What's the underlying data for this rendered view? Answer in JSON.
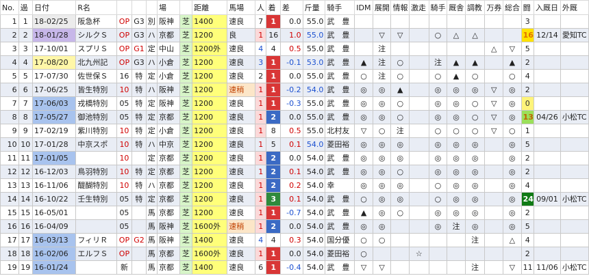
{
  "headers": [
    "No.",
    "過",
    "日付",
    "R名",
    "",
    "",
    "",
    "場",
    "",
    "距離",
    "馬場",
    "人",
    "着",
    "差",
    "斤量",
    "騎手",
    "IDM",
    "展開",
    "情報",
    "激走",
    "騎手",
    "厩舎",
    "調教",
    "万券",
    "総合",
    "闘",
    "入厩日",
    "外厩"
  ],
  "rows": [
    {
      "no": "1",
      "ka": "1",
      "date": "18-02/25",
      "rname": "阪急杯",
      "cls": "OP",
      "g": "G3",
      "j": "別",
      "place": "阪神",
      "track": "芝",
      "dist": "1400",
      "baba": "速良",
      "pop": "7",
      "rank": "1",
      "diff": "0.0",
      "kin": "55.0",
      "jockey": "武　豊",
      "idm": "",
      "tenkai": "",
      "info": "",
      "gekiso": "",
      "jm": "",
      "kyu": "",
      "cho": "",
      "man": "",
      "sogo": "",
      "to": "3",
      "nyu": "",
      "gai": ""
    },
    {
      "no": "2",
      "ka": "2",
      "date": "18-01/28",
      "rname": "シルクＳ",
      "cls": "OP",
      "g": "G3",
      "j": "ハ",
      "place": "京都",
      "track": "芝",
      "dist": "1200",
      "baba": "良",
      "pop": "1",
      "rank": "16",
      "diff": "1.0",
      "kin": "55.0",
      "jockey": "武　豊",
      "idm": "",
      "tenkai": "▽",
      "info": "▽",
      "gekiso": "",
      "jm": "○",
      "kyu": "△",
      "cho": "△",
      "man": "",
      "sogo": "",
      "to": "16",
      "nyu": "12/14",
      "gai": "愛知TC"
    },
    {
      "no": "3",
      "ka": "3",
      "date": "17-10/01",
      "rname": "スプリＳ",
      "cls": "OP",
      "g": "G1",
      "j": "定",
      "place": "中山",
      "track": "芝",
      "dist": "1200外",
      "baba": "速良",
      "pop": "4",
      "rank": "4",
      "diff": "0.5",
      "kin": "55.0",
      "jockey": "武　豊",
      "idm": "",
      "tenkai": "注",
      "info": "",
      "gekiso": "",
      "jm": "",
      "kyu": "",
      "cho": "",
      "man": "△",
      "sogo": "▽",
      "to": "5",
      "nyu": "",
      "gai": ""
    },
    {
      "no": "4",
      "ka": "4",
      "date": "17-08/20",
      "rname": "北九州記",
      "cls": "OP",
      "g": "G3",
      "j": "ハ",
      "place": "小倉",
      "track": "芝",
      "dist": "1200",
      "baba": "速良",
      "pop": "3",
      "rank": "1",
      "diff": "-0.1",
      "kin": "53.0",
      "jockey": "武　豊",
      "idm": "▲",
      "tenkai": "注",
      "info": "○",
      "gekiso": "",
      "jm": "注",
      "kyu": "▲",
      "cho": "▲",
      "man": "",
      "sogo": "▲",
      "to": "2",
      "nyu": "",
      "gai": ""
    },
    {
      "no": "5",
      "ka": "5",
      "date": "17-07/30",
      "rname": "佐世保Ｓ",
      "cls": "16",
      "g": "特",
      "j": "定",
      "place": "小倉",
      "track": "芝",
      "dist": "1200",
      "baba": "速良",
      "pop": "2",
      "rank": "1",
      "diff": "0.0",
      "kin": "55.0",
      "jockey": "武　豊",
      "idm": "○",
      "tenkai": "注",
      "info": "○",
      "gekiso": "",
      "jm": "○",
      "kyu": "▲",
      "cho": "○",
      "man": "",
      "sogo": "○",
      "to": "4",
      "nyu": "",
      "gai": ""
    },
    {
      "no": "6",
      "ka": "6",
      "date": "17-06/25",
      "rname": "皆生特別",
      "cls": "10",
      "g": "特",
      "j": "ハ",
      "place": "阪神",
      "track": "芝",
      "dist": "1200",
      "baba": "速稍",
      "pop": "1",
      "rank": "1",
      "diff": "-0.2",
      "kin": "54.0",
      "jockey": "武　豊",
      "idm": "◎",
      "tenkai": "◎",
      "info": "▲",
      "gekiso": "",
      "jm": "◎",
      "kyu": "◎",
      "cho": "◎",
      "man": "▽",
      "sogo": "◎",
      "to": "2",
      "nyu": "",
      "gai": ""
    },
    {
      "no": "7",
      "ka": "7",
      "date": "17-06/03",
      "rname": "戎橋特別",
      "cls": "05",
      "g": "特",
      "j": "定",
      "place": "阪神",
      "track": "芝",
      "dist": "1200",
      "baba": "速良",
      "pop": "1",
      "rank": "1",
      "diff": "-0.3",
      "kin": "55.0",
      "jockey": "武　豊",
      "idm": "◎",
      "tenkai": "◎",
      "info": "○",
      "gekiso": "",
      "jm": "◎",
      "kyu": "◎",
      "cho": "○",
      "man": "▽",
      "sogo": "◎",
      "to": "0",
      "nyu": "",
      "gai": ""
    },
    {
      "no": "8",
      "ka": "8",
      "date": "17-05/27",
      "rname": "御池特別",
      "cls": "05",
      "g": "特",
      "j": "定",
      "place": "京都",
      "track": "芝",
      "dist": "1200",
      "baba": "速良",
      "pop": "1",
      "rank": "2",
      "diff": "0.0",
      "kin": "55.0",
      "jockey": "武　豊",
      "idm": "◎",
      "tenkai": "◎",
      "info": "○",
      "gekiso": "",
      "jm": "◎",
      "kyu": "◎",
      "cho": "○",
      "man": "▽",
      "sogo": "◎",
      "to": "13",
      "nyu": "04/26",
      "gai": "小松TC"
    },
    {
      "no": "9",
      "ka": "9",
      "date": "17-02/19",
      "rname": "紫川特別",
      "cls": "10",
      "g": "特",
      "j": "定",
      "place": "小倉",
      "track": "芝",
      "dist": "1200",
      "baba": "速良",
      "pop": "1",
      "rank": "8",
      "diff": "0.5",
      "kin": "55.0",
      "jockey": "北村友",
      "idm": "▽",
      "tenkai": "○",
      "info": "注",
      "gekiso": "",
      "jm": "○",
      "kyu": "○",
      "cho": "○",
      "man": "▽",
      "sogo": "○",
      "to": "1",
      "nyu": "",
      "gai": ""
    },
    {
      "no": "10",
      "ka": "10",
      "date": "17-01/28",
      "rname": "中京スポ",
      "cls": "10",
      "g": "特",
      "j": "ハ",
      "place": "中京",
      "track": "芝",
      "dist": "1200",
      "baba": "速良",
      "pop": "1",
      "rank": "5",
      "diff": "0.1",
      "kin": "54.0",
      "jockey": "菱田裕",
      "idm": "◎",
      "tenkai": "◎",
      "info": "◎",
      "gekiso": "",
      "jm": "◎",
      "kyu": "◎",
      "cho": "◎",
      "man": "",
      "sogo": "◎",
      "to": "5",
      "nyu": "",
      "gai": ""
    },
    {
      "no": "11",
      "ka": "11",
      "date": "17-01/05",
      "rname": "",
      "cls": "10",
      "g": "",
      "j": "定",
      "place": "京都",
      "track": "芝",
      "dist": "1200",
      "baba": "速良",
      "pop": "1",
      "rank": "2",
      "diff": "0.0",
      "kin": "54.0",
      "jockey": "武　豊",
      "idm": "◎",
      "tenkai": "◎",
      "info": "◎",
      "gekiso": "",
      "jm": "◎",
      "kyu": "◎",
      "cho": "◎",
      "man": "",
      "sogo": "◎",
      "to": "2",
      "nyu": "",
      "gai": ""
    },
    {
      "no": "12",
      "ka": "12",
      "date": "16-12/03",
      "rname": "鳥羽特別",
      "cls": "10",
      "g": "特",
      "j": "定",
      "place": "京都",
      "track": "芝",
      "dist": "1200",
      "baba": "速良",
      "pop": "1",
      "rank": "2",
      "diff": "0.1",
      "kin": "54.0",
      "jockey": "武　豊",
      "idm": "◎",
      "tenkai": "◎",
      "info": "○",
      "gekiso": "",
      "jm": "◎",
      "kyu": "◎",
      "cho": "◎",
      "man": "",
      "sogo": "◎",
      "to": "2",
      "nyu": "",
      "gai": ""
    },
    {
      "no": "13",
      "ka": "13",
      "date": "16-11/06",
      "rname": "醍醐特別",
      "cls": "10",
      "g": "特",
      "j": "ハ",
      "place": "京都",
      "track": "芝",
      "dist": "1200",
      "baba": "速良",
      "pop": "1",
      "rank": "2",
      "diff": "0.2",
      "kin": "54.0",
      "jockey": "幸",
      "idm": "◎",
      "tenkai": "◎",
      "info": "◎",
      "gekiso": "",
      "jm": "○",
      "kyu": "◎",
      "cho": "◎",
      "man": "",
      "sogo": "◎",
      "to": "4",
      "nyu": "",
      "gai": ""
    },
    {
      "no": "14",
      "ka": "14",
      "date": "16-10/22",
      "rname": "壬生特別",
      "cls": "05",
      "g": "特",
      "j": "定",
      "place": "京都",
      "track": "芝",
      "dist": "1200",
      "baba": "速良",
      "pop": "1",
      "rank": "3",
      "diff": "0.1",
      "kin": "54.0",
      "jockey": "武　豊",
      "idm": "○",
      "tenkai": "◎",
      "info": "◎",
      "gekiso": "",
      "jm": "○",
      "kyu": "◎",
      "cho": "◎",
      "man": "",
      "sogo": "◎",
      "to": "24",
      "nyu": "09/01",
      "gai": "小松TC"
    },
    {
      "no": "15",
      "ka": "15",
      "date": "16-05/01",
      "rname": "",
      "cls": "05",
      "g": "",
      "j": "馬",
      "place": "京都",
      "track": "芝",
      "dist": "1200",
      "baba": "速良",
      "pop": "1",
      "rank": "1",
      "diff": "-0.7",
      "kin": "54.0",
      "jockey": "武　豊",
      "idm": "▲",
      "tenkai": "◎",
      "info": "○",
      "gekiso": "",
      "jm": "◎",
      "kyu": "◎",
      "cho": "◎",
      "man": "",
      "sogo": "◎",
      "to": "2",
      "nyu": "",
      "gai": ""
    },
    {
      "no": "16",
      "ka": "16",
      "date": "16-04/09",
      "rname": "",
      "cls": "05",
      "g": "",
      "j": "馬",
      "place": "阪神",
      "track": "芝",
      "dist": "1600外",
      "baba": "速稍",
      "pop": "1",
      "rank": "2",
      "diff": "0.0",
      "kin": "54.0",
      "jockey": "武　豊",
      "idm": "◎",
      "tenkai": "◎",
      "info": "",
      "gekiso": "",
      "jm": "◎",
      "kyu": "注",
      "cho": "◎",
      "man": "",
      "sogo": "◎",
      "to": "5",
      "nyu": "",
      "gai": ""
    },
    {
      "no": "17",
      "ka": "17",
      "date": "16-03/13",
      "rname": "フィリＲ",
      "cls": "OP",
      "g": "G2",
      "j": "馬",
      "place": "阪神",
      "track": "芝",
      "dist": "1400",
      "baba": "速良",
      "pop": "4",
      "rank": "4",
      "diff": "0.3",
      "kin": "54.0",
      "jockey": "国分優",
      "idm": "○",
      "tenkai": "○",
      "info": "",
      "gekiso": "",
      "jm": "",
      "kyu": "",
      "cho": "注",
      "man": "",
      "sogo": "△",
      "to": "4",
      "nyu": "",
      "gai": ""
    },
    {
      "no": "18",
      "ka": "18",
      "date": "16-02/06",
      "rname": "エルフＳ",
      "cls": "OP",
      "g": "",
      "j": "馬",
      "place": "京都",
      "track": "芝",
      "dist": "1600外",
      "baba": "速良",
      "pop": "1",
      "rank": "1",
      "diff": "0.0",
      "kin": "54.0",
      "jockey": "菱田裕",
      "idm": "○",
      "tenkai": "",
      "info": "",
      "gekiso": "☆",
      "jm": "",
      "kyu": "",
      "cho": "",
      "man": "",
      "sogo": "",
      "to": "2",
      "nyu": "",
      "gai": ""
    },
    {
      "no": "19",
      "ka": "19",
      "date": "16-01/24",
      "rname": "",
      "cls": "新",
      "g": "",
      "j": "馬",
      "place": "京都",
      "track": "芝",
      "dist": "1400",
      "baba": "速良",
      "pop": "6",
      "rank": "1",
      "diff": "-0.4",
      "kin": "54.0",
      "jockey": "武　豊",
      "idm": "▽",
      "tenkai": "▽",
      "info": "",
      "gekiso": "",
      "jm": "",
      "kyu": "",
      "cho": "注",
      "man": "",
      "sogo": "▽",
      "to": "11",
      "nyu": "11/06",
      "gai": "小松TC"
    }
  ],
  "colors": {
    "win": "#d93636",
    "second": "#3b6ac4",
    "third": "#2f8a3c"
  }
}
